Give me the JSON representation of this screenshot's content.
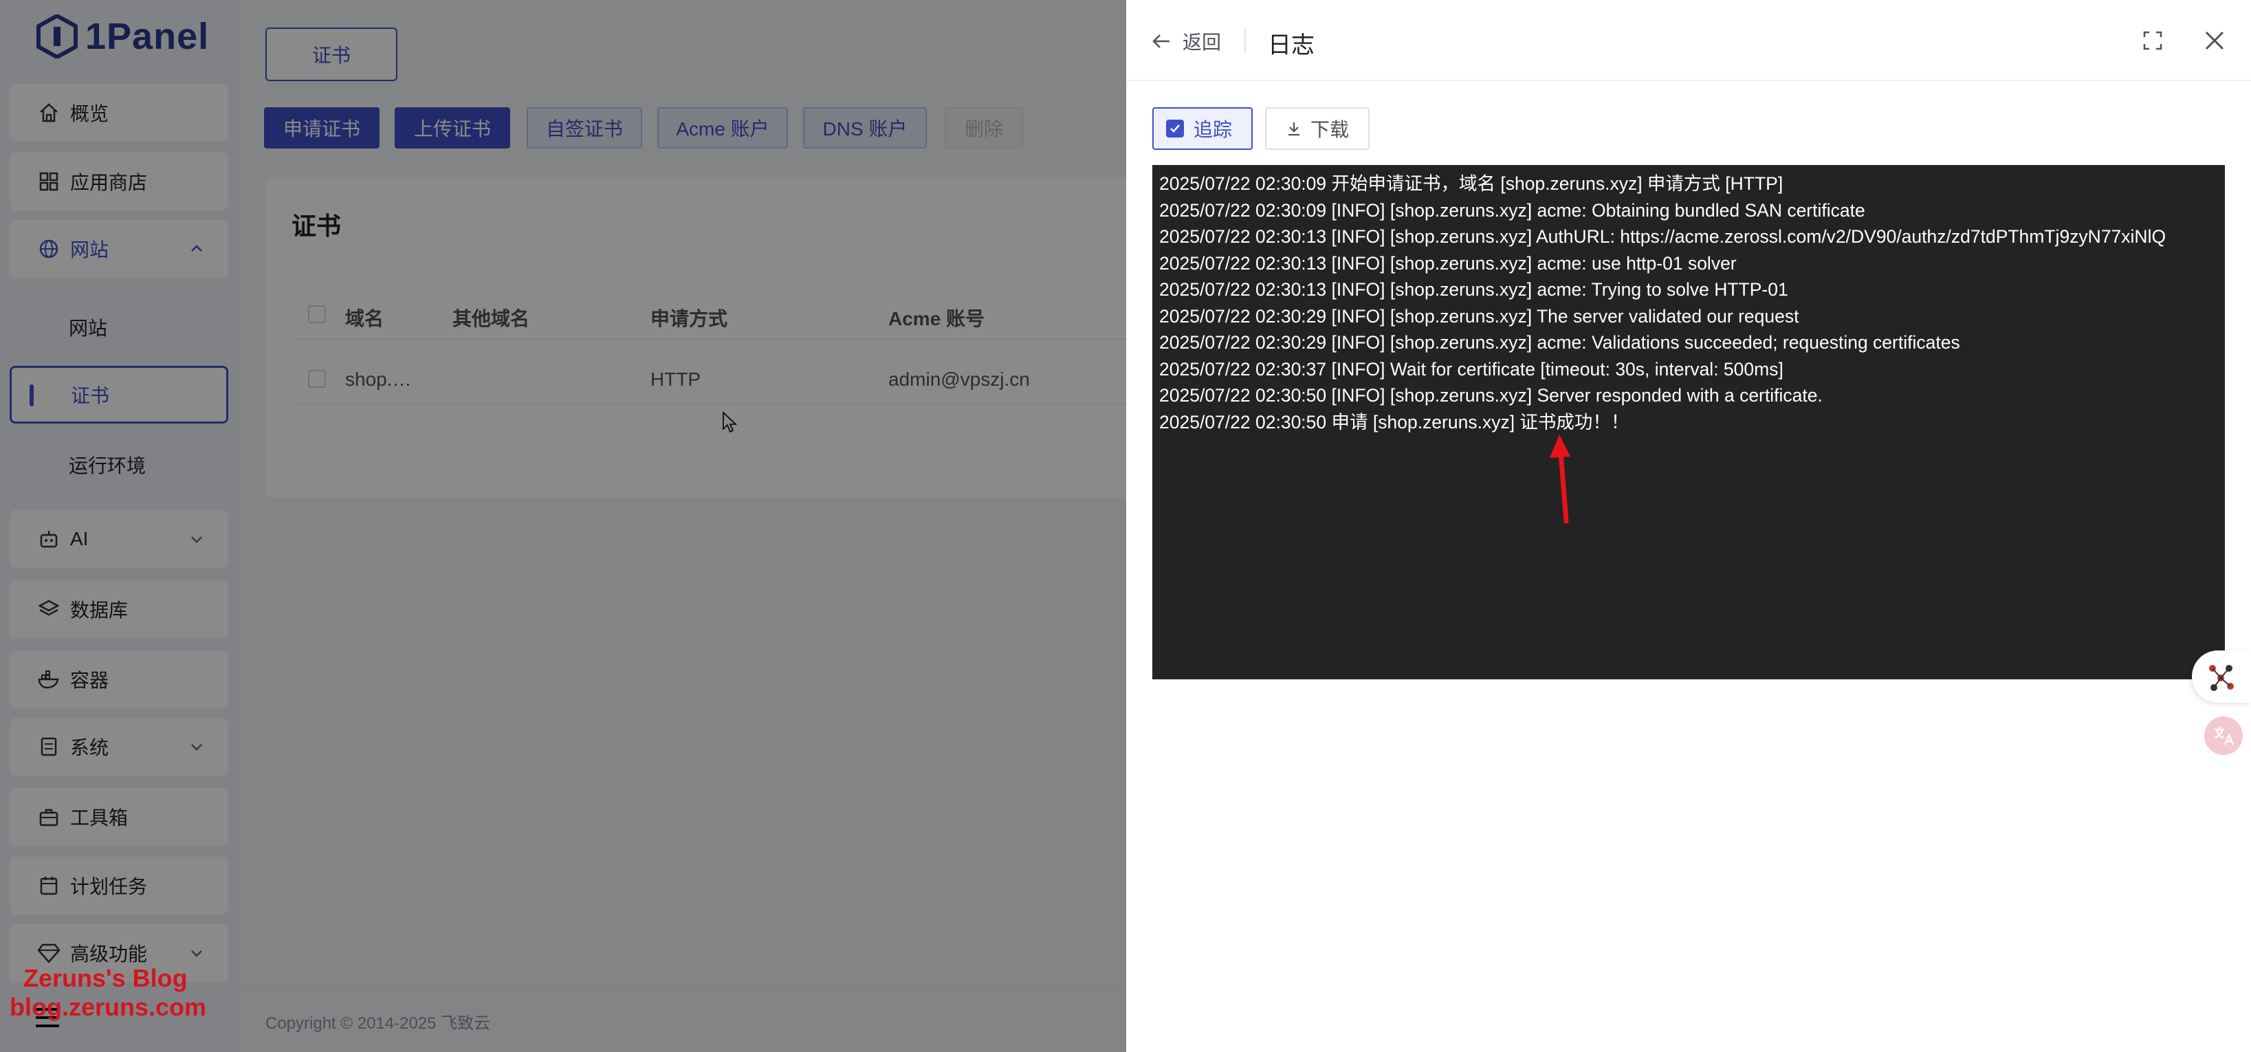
{
  "app": {
    "logo_text": "1Panel"
  },
  "sidebar": {
    "items": [
      {
        "label": "概览",
        "icon": "home-icon"
      },
      {
        "label": "应用商店",
        "icon": "grid-icon"
      },
      {
        "label": "网站",
        "icon": "globe-icon"
      },
      {
        "label": "AI",
        "icon": "robot-icon"
      },
      {
        "label": "数据库",
        "icon": "layers-icon"
      },
      {
        "label": "容器",
        "icon": "docker-icon"
      },
      {
        "label": "系统",
        "icon": "server-icon"
      },
      {
        "label": "工具箱",
        "icon": "toolbox-icon"
      },
      {
        "label": "计划任务",
        "icon": "calendar-icon"
      },
      {
        "label": "高级功能",
        "icon": "diamond-icon"
      }
    ],
    "website_sub": [
      "网站",
      "证书",
      "运行环境"
    ]
  },
  "watermark": {
    "line1": "Zeruns's Blog",
    "line2": "blog.zeruns.com"
  },
  "main": {
    "tab": "证书",
    "toolbar": [
      "申请证书",
      "上传证书",
      "自签证书",
      "Acme 账户",
      "DNS 账户",
      "删除"
    ],
    "card_title": "证书",
    "table": {
      "headers": [
        "域名",
        "其他域名",
        "申请方式",
        "Acme 账号"
      ],
      "rows": [
        {
          "domain": "shop.…",
          "other": "",
          "method": "HTTP",
          "acme": "admin@vpszj.cn"
        }
      ]
    },
    "footer": "Copyright © 2014-2025 飞致云"
  },
  "drawer": {
    "back_label": "返回",
    "title": "日志",
    "follow_label": "追踪",
    "download_label": "下载",
    "log_lines": [
      "2025/07/22 02:30:09 开始申请证书，域名 [shop.zeruns.xyz] 申请方式 [HTTP]",
      "2025/07/22 02:30:09 [INFO] [shop.zeruns.xyz] acme: Obtaining bundled SAN certificate",
      "2025/07/22 02:30:13 [INFO] [shop.zeruns.xyz] AuthURL: https://acme.zerossl.com/v2/DV90/authz/zd7tdPThmTj9zyN77xiNlQ",
      "2025/07/22 02:30:13 [INFO] [shop.zeruns.xyz] acme: use http-01 solver",
      "2025/07/22 02:30:13 [INFO] [shop.zeruns.xyz] acme: Trying to solve HTTP-01",
      "2025/07/22 02:30:29 [INFO] [shop.zeruns.xyz] The server validated our request",
      "2025/07/22 02:30:29 [INFO] [shop.zeruns.xyz] acme: Validations succeeded; requesting certificates",
      "2025/07/22 02:30:37 [INFO] Wait for certificate [timeout: 30s, interval: 500ms]",
      "2025/07/22 02:30:50 [INFO] [shop.zeruns.xyz] Server responded with a certificate.",
      "2025/07/22 02:30:50 申请 [shop.zeruns.xyz] 证书成功！！"
    ]
  },
  "colors": {
    "primary": "#3d50c7",
    "log_bg": "#232323",
    "annotation": "#e8121b",
    "watermark": "#d3161f"
  }
}
